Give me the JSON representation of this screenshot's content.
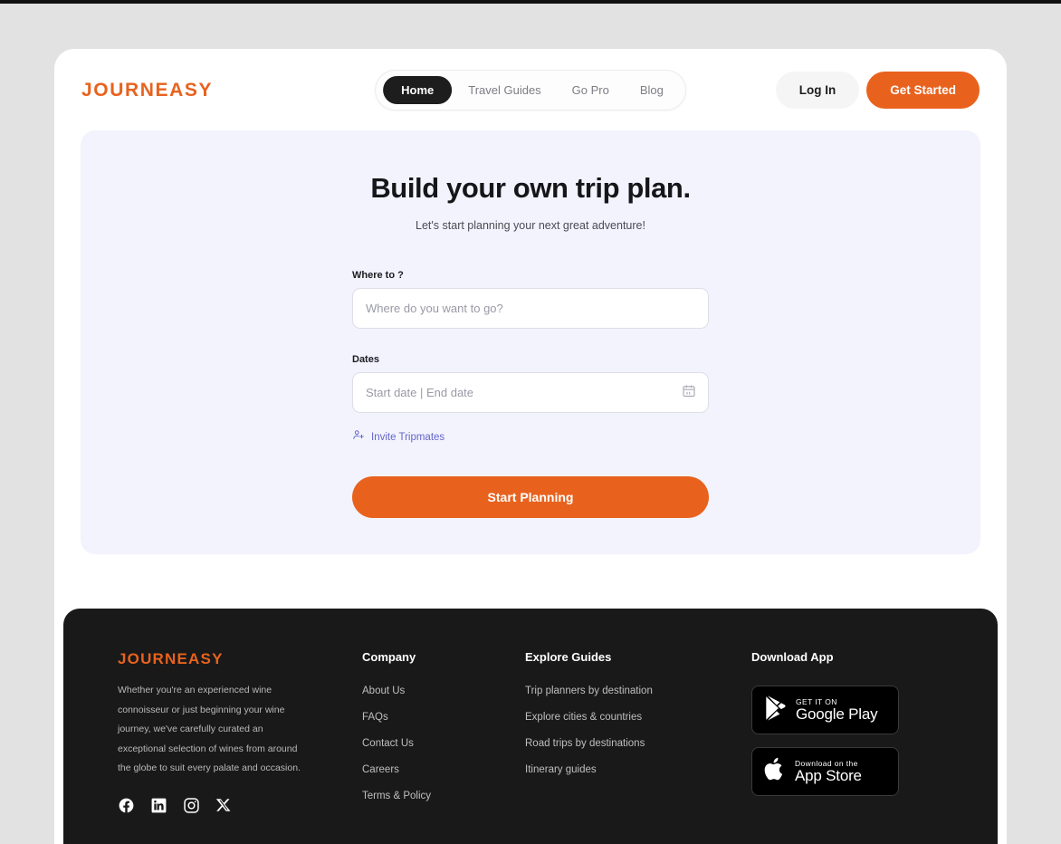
{
  "brand": {
    "name": "JOURNEASY",
    "accent": "#e8621e"
  },
  "nav": {
    "items": [
      {
        "label": "Home",
        "active": true
      },
      {
        "label": "Travel Guides",
        "active": false
      },
      {
        "label": "Go Pro",
        "active": false
      },
      {
        "label": "Blog",
        "active": false
      }
    ],
    "login_label": "Log In",
    "get_started_label": "Get Started"
  },
  "hero": {
    "title": "Build your own trip plan.",
    "subtitle": "Let's start planning your next great adventure!",
    "where_label": "Where to ?",
    "where_placeholder": "Where do you want to go?",
    "dates_label": "Dates",
    "dates_placeholder": "Start date | End date",
    "invite_label": "Invite Tripmates",
    "invite_color": "#6366c9",
    "cta_label": "Start Planning"
  },
  "footer": {
    "brand_name": "JOURNEASY",
    "description": "Whether you're an experienced wine connoisseur or just beginning your wine journey, we've carefully curated an exceptional selection of wines from around the globe to suit every palate and occasion.",
    "socials": [
      "facebook-icon",
      "linkedin-icon",
      "instagram-icon",
      "x-icon"
    ],
    "company": {
      "heading": "Company",
      "links": [
        "About Us",
        "FAQs",
        "Contact Us",
        "Careers",
        "Terms & Policy"
      ]
    },
    "explore": {
      "heading": "Explore Guides",
      "links": [
        "Trip planners by destination",
        "Explore cities & countries",
        "Road trips by destinations",
        "Itinerary guides"
      ]
    },
    "download": {
      "heading": "Download App",
      "badges": [
        {
          "small": "GET IT ON",
          "big": "Google Play",
          "icon": "google-play-icon"
        },
        {
          "small": "Download on the",
          "big": "App Store",
          "icon": "apple-icon"
        }
      ]
    }
  }
}
